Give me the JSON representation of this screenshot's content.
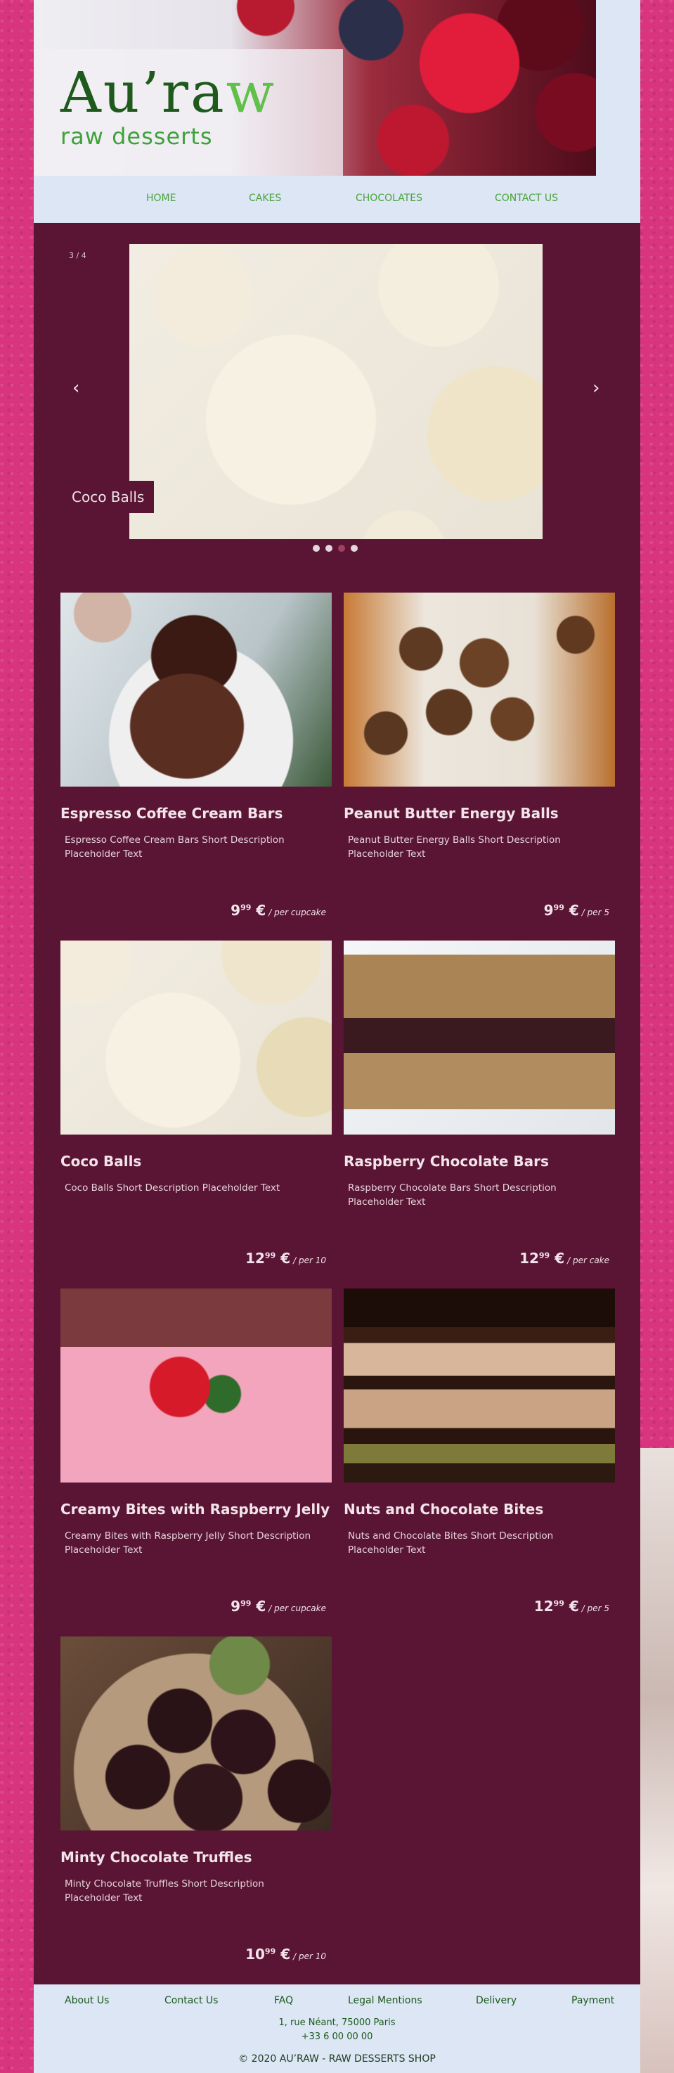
{
  "brand": {
    "name_part1": "Au’ra",
    "name_part2": "w",
    "tagline": "raw desserts"
  },
  "nav": {
    "home": "HOME",
    "cakes": "CAKES",
    "chocolates": "CHOCOLATES",
    "contact": "CONTACT US"
  },
  "slider": {
    "counter": "3 / 4",
    "caption": "Coco Balls",
    "prev": "‹",
    "next": "›",
    "active_index": 2,
    "total": 4
  },
  "products": [
    {
      "name": "Espresso Coffee Cream Bars",
      "desc": "Espresso Coffee Cream Bars Short Description Placeholder Text",
      "price_main": "9",
      "price_cents": "99",
      "currency": "€",
      "per": "/ per cupcake"
    },
    {
      "name": "Peanut Butter Energy Balls",
      "desc": "Peanut Butter Energy Balls Short Description Placeholder Text",
      "price_main": "9",
      "price_cents": "99",
      "currency": "€",
      "per": "/ per 5"
    },
    {
      "name": "Coco Balls",
      "desc": "Coco Balls Short Description Placeholder Text",
      "price_main": "12",
      "price_cents": "99",
      "currency": "€",
      "per": "/ per 10"
    },
    {
      "name": "Raspberry Chocolate Bars",
      "desc": "Raspberry Chocolate Bars Short Description Placeholder Text",
      "price_main": "12",
      "price_cents": "99",
      "currency": "€",
      "per": "/ per cake"
    },
    {
      "name": "Creamy Bites with Raspberry Jelly",
      "desc": "Creamy Bites with Raspberry Jelly Short Description Placeholder Text",
      "price_main": "9",
      "price_cents": "99",
      "currency": "€",
      "per": "/ per cupcake"
    },
    {
      "name": "Nuts and Chocolate Bites",
      "desc": "Nuts and Chocolate Bites Short Description Placeholder Text",
      "price_main": "12",
      "price_cents": "99",
      "currency": "€",
      "per": "/ per 5"
    },
    {
      "name": "Minty Chocolate Truffles",
      "desc": "Minty Chocolate Truffles Short Description Placeholder Text",
      "price_main": "10",
      "price_cents": "99",
      "currency": "€",
      "per": "/ per 10"
    }
  ],
  "footer": {
    "links": [
      "About Us",
      "Contact Us",
      "FAQ",
      "Legal Mentions",
      "Delivery",
      "Payment"
    ],
    "address_line1": "1, rue Néant, 75000 Paris",
    "address_line2": "+33 6 00 00 00",
    "copyright_prefix": "© 2020 ",
    "copyright_brand": "AU’RAW",
    "copyright_suffix": " - RAW DESSERTS SHOP"
  },
  "colors": {
    "page_bg": "#d9357f",
    "content_bg": "#591533",
    "header_bg": "#dce6f5",
    "accent_green": "#4ba33c",
    "dark_green": "#1e5a1c"
  }
}
